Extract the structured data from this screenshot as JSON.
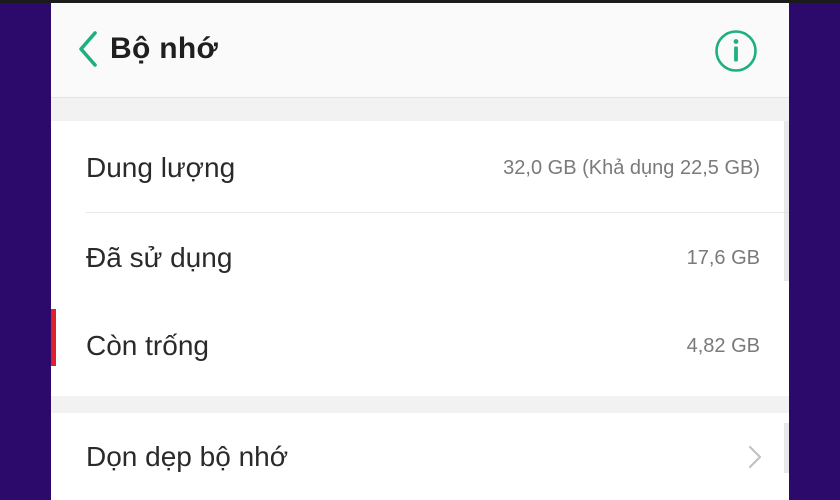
{
  "header": {
    "title": "Bộ nhớ",
    "back_icon": "chevron-left-icon",
    "info_icon": "info-icon",
    "accent_color": "#1fb07f"
  },
  "storage": {
    "items": [
      {
        "label": "Dung lượng",
        "value": "32,0 GB (Khả dụng 22,5 GB)"
      },
      {
        "label": "Đã sử dụng",
        "value": "17,6 GB"
      },
      {
        "label": "Còn trống",
        "value": "4,82 GB"
      }
    ]
  },
  "actions": {
    "clean_label": "Dọn dẹp bộ nhớ",
    "clean_icon": "chevron-right-icon"
  },
  "colors": {
    "background": "#2c0a6b",
    "marker": "#e0202a"
  }
}
